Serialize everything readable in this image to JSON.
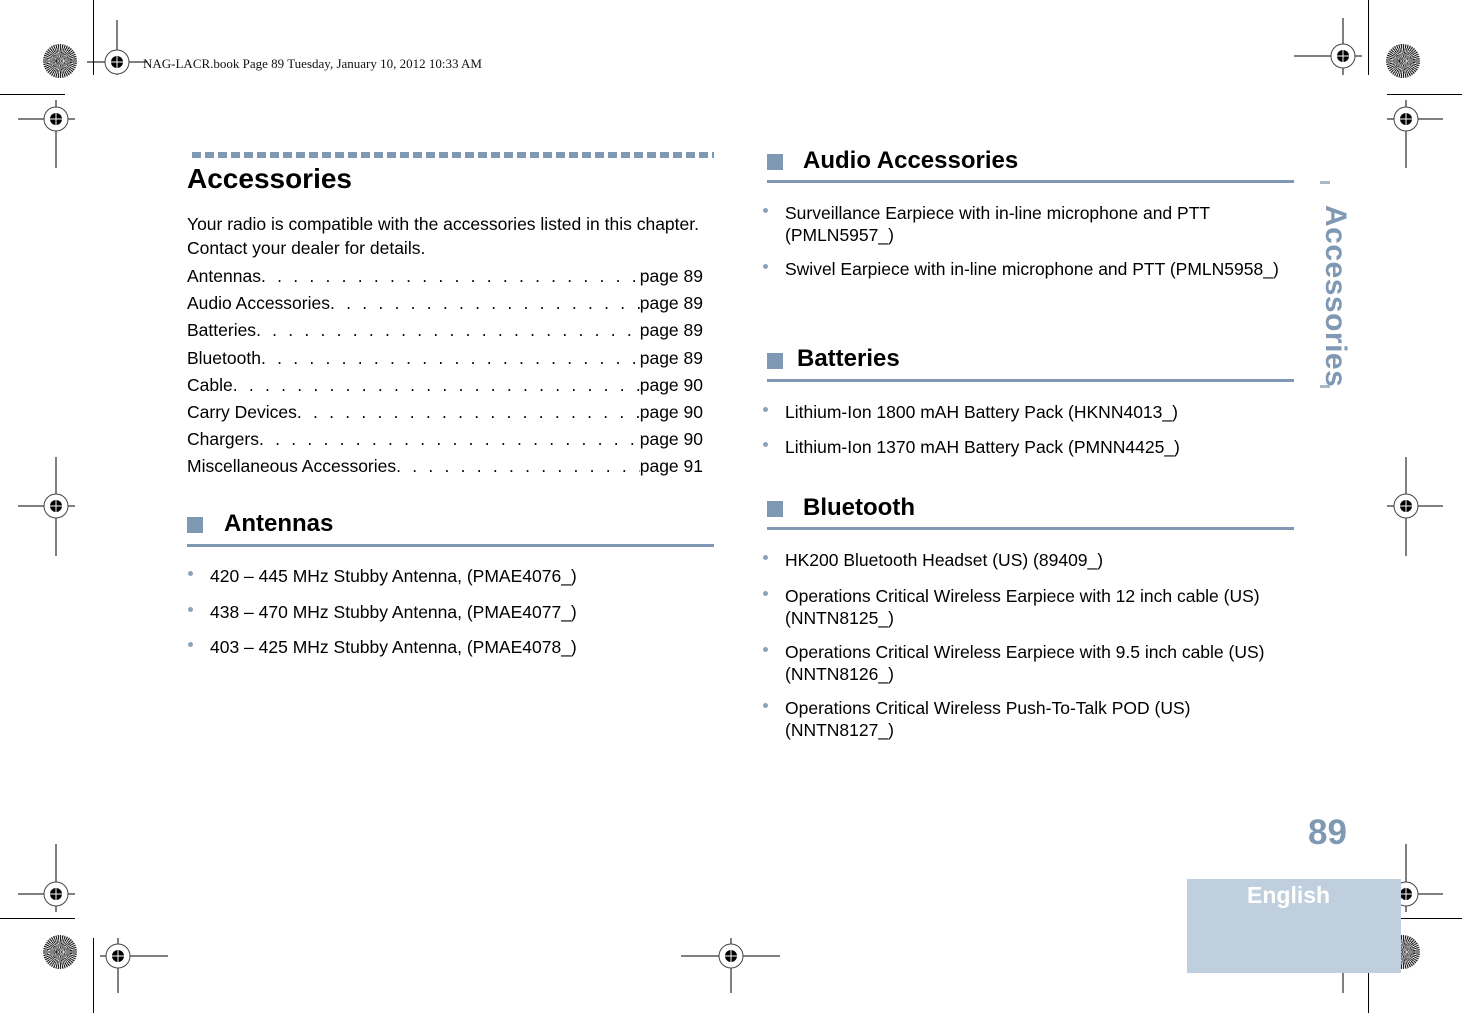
{
  "header": {
    "print_info": "NAG-LACR.book  Page 89  Tuesday, January 10, 2012  10:33 AM"
  },
  "chapter": {
    "title": "Accessories",
    "intro": "Your radio is compatible with the accessories listed in this chapter. Contact your dealer for details.",
    "toc": [
      {
        "label": "Antennas",
        "page": "page 89"
      },
      {
        "label": "Audio Accessories",
        "page": "page 89"
      },
      {
        "label": "Batteries ",
        "page": "page 89"
      },
      {
        "label": "Bluetooth",
        "page": "page 89"
      },
      {
        "label": "Cable",
        "page": "page 90"
      },
      {
        "label": "Carry Devices ",
        "page": "page 90"
      },
      {
        "label": "Chargers ",
        "page": "page 90"
      },
      {
        "label": "Miscellaneous Accessories ",
        "page": "page 91"
      }
    ]
  },
  "sections": {
    "antennas": {
      "title": "Antennas",
      "items": [
        "420 – 445 MHz Stubby Antenna, (PMAE4076_)",
        "438 – 470 MHz Stubby Antenna, (PMAE4077_)",
        "403 – 425 MHz Stubby Antenna, (PMAE4078_)"
      ]
    },
    "audio": {
      "title": "Audio Accessories",
      "items": [
        "Surveillance Earpiece with in-line microphone and PTT (PMLN5957_)",
        "Swivel Earpiece with in-line microphone and PTT (PMLN5958_)"
      ]
    },
    "batteries": {
      "title": "Batteries",
      "items": [
        "Lithium-Ion 1800 mAH Battery Pack (HKNN4013_)",
        "Lithium-Ion 1370 mAH Battery Pack (PMNN4425_)"
      ]
    },
    "bluetooth": {
      "title": "Bluetooth",
      "items": [
        "HK200 Bluetooth Headset (US) (89409_)",
        "Operations Critical Wireless Earpiece with 12 inch cable (US) (NNTN8125_)",
        "Operations Critical Wireless Earpiece with 9.5 inch cable (US) (NNTN8126_)",
        "Operations Critical Wireless Push-To-Talk POD (US) (NNTN8127_)"
      ]
    }
  },
  "side_tab": {
    "label": "Accessories"
  },
  "footer": {
    "page_number": "89",
    "language": "English"
  },
  "colors": {
    "accent": "#7f99b5",
    "language_box": "#c0cfdd"
  }
}
